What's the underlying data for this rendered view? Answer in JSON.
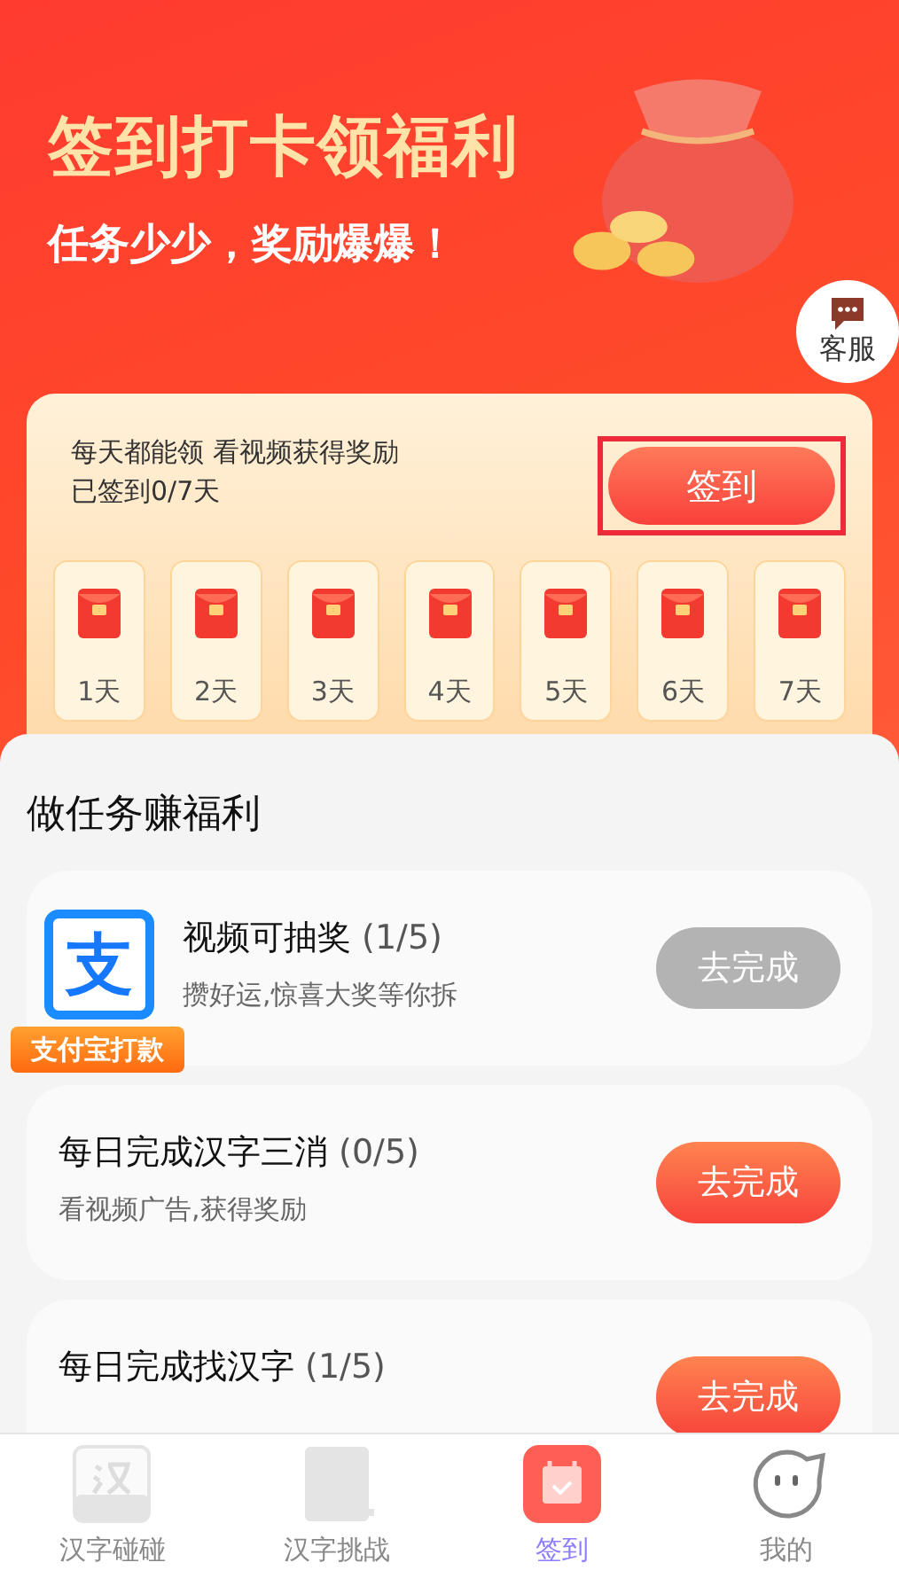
{
  "banner": {
    "title": "签到打卡领福利",
    "subtitle": "任务少少，奖励爆爆！"
  },
  "service": {
    "label": "客服"
  },
  "signin": {
    "line1": "每天都能领  看视频获得奖励",
    "line2": "已签到0/7天",
    "button": "签到",
    "highlighted": true,
    "days": [
      {
        "label": "1天",
        "signed": false
      },
      {
        "label": "2天",
        "signed": false
      },
      {
        "label": "3天",
        "signed": false
      },
      {
        "label": "4天",
        "signed": false
      },
      {
        "label": "5天",
        "signed": false
      },
      {
        "label": "6天",
        "signed": false
      },
      {
        "label": "7天",
        "signed": false
      }
    ]
  },
  "tasks_title": "做任务赚福利",
  "tasks": [
    {
      "title": "视频可抽奖",
      "count": "(1/5)",
      "desc": "攒好运,惊喜大奖等你拆",
      "button": "去完成",
      "disabled": true
    },
    {
      "title": "每日完成汉字三消",
      "count": "(0/5)",
      "desc": "看视频广告,获得奖励",
      "button": "去完成",
      "disabled": false
    },
    {
      "title": "每日完成找汉字",
      "count": "(1/5)",
      "button": "去完成",
      "disabled": false
    }
  ],
  "promo": {
    "glyph": "支",
    "label": "支付宝打款"
  },
  "tabs": [
    {
      "label": "汉字碰碰",
      "selected": false
    },
    {
      "label": "汉字挑战",
      "selected": false
    },
    {
      "label": "签到",
      "selected": true
    },
    {
      "label": "我的",
      "selected": false
    }
  ]
}
